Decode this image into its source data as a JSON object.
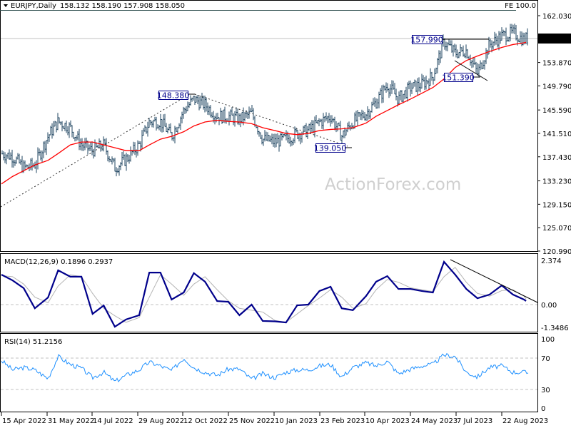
{
  "header": {
    "symbol_label": "EURJPY,Daily",
    "ohlc_label": "158.132 158.190 157.908 158.050",
    "fe_label": "FE 100.0",
    "current_price_label": "158.050",
    "watermark": "ActionForex.com"
  },
  "colors": {
    "bars": "#1f4460",
    "moving_average": "#ff0000",
    "macd": "#00008b",
    "signal": "#b4b4b4",
    "rsi": "#1e90ff",
    "annotation": "#00008b"
  },
  "chart_data": [
    {
      "type": "line",
      "panel": "price",
      "title": "EURJPY,Daily",
      "ylim": [
        120.99,
        162.03
      ],
      "y_ticks": [
        "162.030",
        "158.050",
        "153.870",
        "149.790",
        "145.590",
        "141.510",
        "137.430",
        "133.230",
        "129.150",
        "125.070",
        "120.990"
      ],
      "x_ticks": [
        "15 Apr 2022",
        "31 May 2022",
        "14 Jul 2022",
        "29 Aug 2022",
        "12 Oct 2022",
        "25 Nov 2022",
        "10 Jan 2023",
        "23 Feb 2023",
        "10 Apr 2023",
        "24 May 2023",
        "7 Jul 2023",
        "22 Aug 2023"
      ],
      "dates": [
        "2022-04-15",
        "2022-04-26",
        "2022-05-07",
        "2022-05-18",
        "2022-05-31",
        "2022-06-10",
        "2022-06-22",
        "2022-07-03",
        "2022-07-14",
        "2022-07-25",
        "2022-08-05",
        "2022-08-16",
        "2022-08-29",
        "2022-09-08",
        "2022-09-19",
        "2022-09-30",
        "2022-10-12",
        "2022-10-22",
        "2022-11-02",
        "2022-11-14",
        "2022-11-25",
        "2022-12-06",
        "2022-12-18",
        "2022-12-29",
        "2023-01-10",
        "2023-01-21",
        "2023-02-01",
        "2023-02-12",
        "2023-02-23",
        "2023-03-06",
        "2023-03-17",
        "2023-03-28",
        "2023-04-10",
        "2023-04-20",
        "2023-05-01",
        "2023-05-12",
        "2023-05-24",
        "2023-06-04",
        "2023-06-15",
        "2023-06-26",
        "2023-07-07",
        "2023-07-18",
        "2023-07-29",
        "2023-08-10",
        "2023-08-22",
        "2023-09-02",
        "2023-09-13",
        "2023-09-15"
      ],
      "series": [
        {
          "values": [
            138.0,
            137.5,
            135.5,
            136.0,
            141.0,
            143.6,
            142.5,
            139.5,
            138.5,
            139.5,
            135.5,
            137.0,
            139.5,
            143.5,
            143.6,
            141.0,
            145.5,
            147.5,
            146.5,
            144.5,
            144.5,
            144.0,
            145.0,
            140.5,
            140.0,
            140.5,
            141.5,
            142.0,
            143.5,
            144.5,
            141.0,
            143.5,
            145.0,
            147.0,
            150.0,
            147.5,
            149.5,
            150.0,
            151.5,
            157.5,
            155.5,
            156.0,
            152.0,
            157.0,
            158.5,
            159.0,
            157.8,
            158.05
          ]
        },
        {
          "values": [
            132.7,
            134.0,
            135.0,
            136.0,
            136.8,
            138.0,
            139.5,
            140.0,
            140.0,
            139.5,
            139.0,
            138.5,
            138.5,
            139.5,
            140.5,
            141.0,
            141.8,
            142.8,
            143.5,
            143.8,
            143.6,
            143.5,
            143.2,
            142.5,
            142.0,
            141.5,
            141.3,
            141.5,
            142.0,
            142.2,
            142.3,
            142.5,
            143.3,
            144.5,
            145.5,
            146.5,
            147.5,
            148.5,
            149.5,
            151.0,
            153.0,
            154.2,
            155.0,
            155.8,
            156.5,
            157.0,
            157.3,
            157.4
          ]
        }
      ],
      "current_price": 158.05,
      "annotations": [
        {
          "label": "148.380",
          "price": 148.38,
          "date": "2022-10-20"
        },
        {
          "label": "139.050",
          "price": 139.05,
          "date": "2023-03-14"
        },
        {
          "label": "157.990",
          "price": 157.99,
          "date": "2023-06-26"
        },
        {
          "label": "151.390",
          "price": 151.39,
          "date": "2023-07-28"
        }
      ]
    },
    {
      "type": "line",
      "panel": "macd",
      "title": "MACD(12,26,9) 0.1896 0.2937",
      "ylim": [
        -1.3486,
        2.374
      ],
      "y_ticks": [
        "2.374",
        "0.00",
        "-1.3486"
      ],
      "series": [
        {
          "values": [
            1.61,
            1.3,
            0.88,
            -0.2,
            0.38,
            1.84,
            1.5,
            1.5,
            -0.5,
            -0.05,
            -1.19,
            -0.8,
            -0.57,
            1.72,
            1.72,
            0.27,
            0.65,
            1.69,
            1.23,
            0.19,
            0.15,
            -0.57,
            0.0,
            -0.88,
            -0.9,
            -0.96,
            -0.04,
            0.0,
            0.73,
            0.96,
            -0.2,
            -0.3,
            0.46,
            1.23,
            1.53,
            0.84,
            0.84,
            0.73,
            0.65,
            2.3,
            1.61,
            0.84,
            0.34,
            0.54,
            1.03,
            0.54,
            0.27,
            0.19
          ]
        },
        {
          "values": [
            1.55,
            1.5,
            1.1,
            0.4,
            0.1,
            1.0,
            1.6,
            1.5,
            0.6,
            -0.2,
            -0.6,
            -0.95,
            -0.7,
            0.4,
            1.6,
            1.1,
            0.5,
            1.1,
            1.5,
            0.8,
            0.2,
            -0.2,
            -0.3,
            -0.4,
            -0.85,
            -0.95,
            -0.5,
            -0.05,
            0.35,
            0.8,
            0.4,
            -0.2,
            0.05,
            0.8,
            1.35,
            1.2,
            0.9,
            0.8,
            0.7,
            1.5,
            2.0,
            1.2,
            0.6,
            0.45,
            0.75,
            0.8,
            0.45,
            0.29
          ]
        }
      ]
    },
    {
      "type": "line",
      "panel": "rsi",
      "title": "RSI(14) 51.2156",
      "ylim": [
        0,
        100
      ],
      "y_ticks": [
        "100",
        "70",
        "30",
        "0"
      ],
      "levels": [
        70,
        30
      ],
      "series": [
        {
          "values": [
            67,
            55,
            58,
            55,
            44,
            72,
            62,
            57,
            45,
            52,
            40,
            48,
            55,
            65,
            60,
            54,
            70,
            58,
            52,
            48,
            56,
            56,
            43,
            50,
            45,
            52,
            55,
            55,
            60,
            62,
            46,
            58,
            64,
            60,
            66,
            50,
            56,
            60,
            62,
            74,
            72,
            52,
            46,
            58,
            60,
            52,
            52,
            51.2
          ]
        }
      ]
    }
  ]
}
